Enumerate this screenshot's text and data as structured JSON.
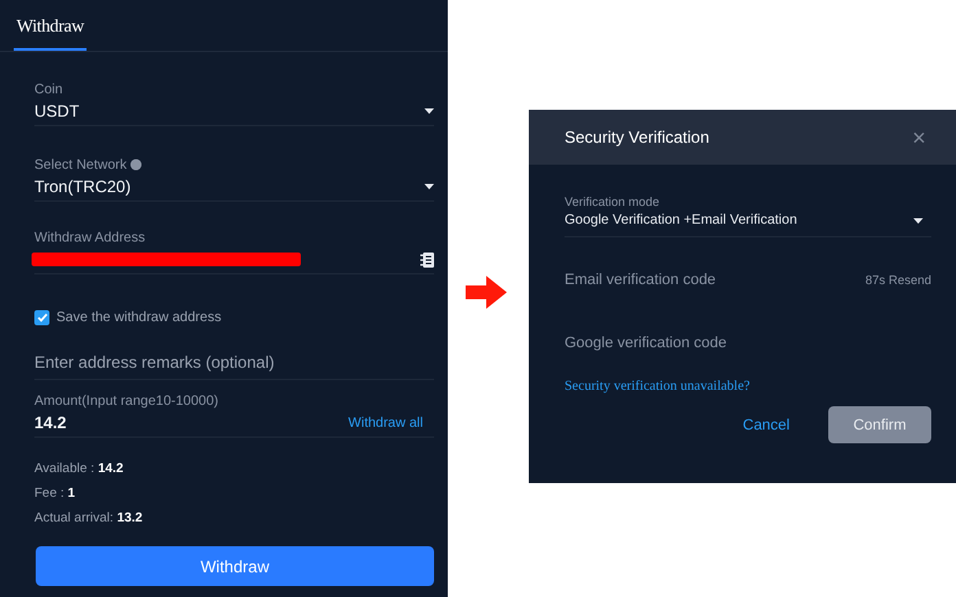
{
  "withdraw_panel": {
    "tabs": [
      {
        "label": "Withdraw",
        "selected": true
      }
    ],
    "coin": {
      "label": "Coin",
      "value": "USDT"
    },
    "network": {
      "label": "Select Network",
      "value": "Tron(TRC20)"
    },
    "address": {
      "label": "Withdraw Address",
      "redacted": true
    },
    "save_address": {
      "label": "Save the withdraw address",
      "checked": true
    },
    "remarks": {
      "placeholder": "Enter address remarks (optional)"
    },
    "amount": {
      "label": "Amount(Input range10-10000)",
      "value": "14.2",
      "action": "Withdraw all"
    },
    "summary": [
      "Available : **14.2**",
      "Fee : **1**",
      "Actual arrival: **13.2**"
    ],
    "submit": "Withdraw"
  },
  "dialog": {
    "title": "Security Verification",
    "close": "×",
    "mode": {
      "label": "Verification mode",
      "value": "Google Verification +Email Verification"
    },
    "email_code": {
      "placeholder": "Email verification code",
      "resend": "87s Resend"
    },
    "google_code": {
      "placeholder": "Google verification code"
    },
    "help_link": "Security verification unavailable?",
    "buttons": [
      {
        "label": "Cancel",
        "kind": "text",
        "disabled": false
      },
      {
        "label": "Confirm",
        "kind": "filled",
        "disabled": true
      }
    ]
  }
}
